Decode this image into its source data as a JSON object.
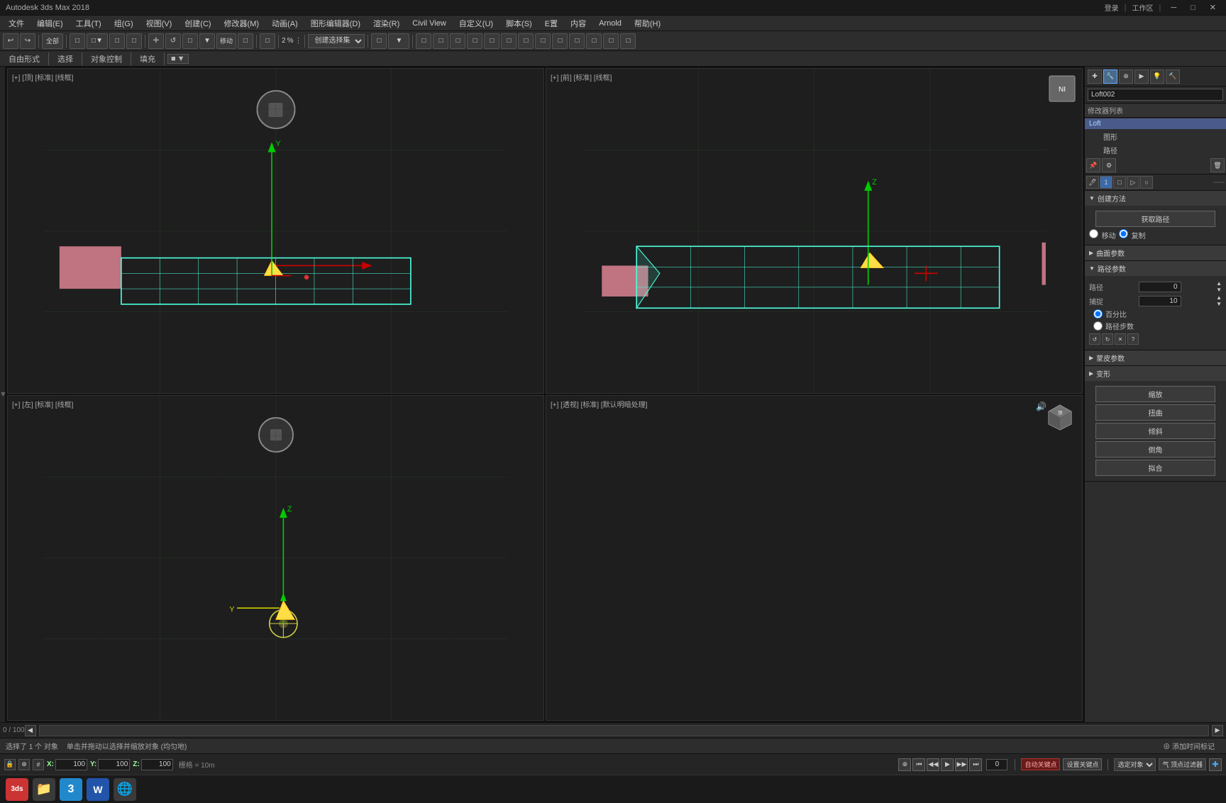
{
  "titleBar": {
    "title": "Autodesk 3ds Max 2018"
  },
  "menuBar": {
    "items": [
      "文件",
      "编辑(E)",
      "工具(T)",
      "组(G)",
      "视图(V)",
      "创建(C)",
      "修改器(M)",
      "动画(A)",
      "图形编辑器(D)",
      "渲染(R)",
      "Civil View",
      "自定义(U)",
      "脚本(S)",
      "E置",
      "内容",
      "Arnold",
      "帮助(H)"
    ]
  },
  "toolbar": {
    "items": [
      "↩",
      "↪",
      "✕",
      "□",
      "□",
      "□",
      "⊕",
      "↺",
      "□",
      "□",
      "□",
      "□",
      "移动",
      "□",
      "□",
      "□",
      "□",
      "□",
      "□",
      "□",
      "□",
      "□",
      "□",
      "□"
    ],
    "dropdown": "创建选择集",
    "percentLabel": "2",
    "percentLabel2": "%"
  },
  "toolbar2": {
    "items": [
      "自由形式",
      "选择",
      "对象控制",
      "填充",
      "■▼"
    ]
  },
  "viewports": {
    "topLeft": {
      "label": "[+] [顶] [标准] [线框]"
    },
    "topRight": {
      "label": "[+] [前] [标准] [线框]"
    },
    "bottomLeft": {
      "label": "[+] [左] [标准] [线框]"
    },
    "bottomRight": {
      "label": "[+] [透视] [标准] [默认明暗处理]"
    }
  },
  "rightPanel": {
    "objectName": "Loft002",
    "modifierListLabel": "修改器列表",
    "buttons": {
      "pin": "📌",
      "config": "⚙",
      "trash": "🗑",
      "check": "✓",
      "close": "✕"
    },
    "modifiers": [
      {
        "name": "Loft",
        "active": true
      },
      {
        "name": "图形",
        "sub": true
      },
      {
        "name": "路径",
        "sub": true
      }
    ],
    "sections": {
      "creationMethod": {
        "label": "创建方法",
        "items": [
          "获取路径",
          "移动",
          "复制"
        ]
      },
      "surfaceParams": {
        "label": "曲面参数"
      },
      "pathParams": {
        "label": "路径参数",
        "path": {
          "label": "路径",
          "value": "0"
        },
        "snap": {
          "label": "捕捉",
          "value": "10"
        },
        "pct": "百分比",
        "pctLabel": "路径步数"
      },
      "skinParams": {
        "label": "蒙皮参数"
      },
      "deform": {
        "label": "变形",
        "buttons": [
          "缩放",
          "扭曲",
          "倾斜",
          "倒角",
          "拟合"
        ]
      }
    }
  },
  "statusBar": {
    "selected": "选择了 1 个 对象",
    "hint": "单击并拖动以选择并缩放对象 (均匀地)",
    "coords": {
      "x": {
        "label": "X:",
        "value": "100"
      },
      "y": {
        "label": "Y:",
        "value": "100"
      },
      "z": {
        "label": "Z:",
        "value": "100"
      }
    },
    "grid": "栅格 = 10m",
    "frameCounter": "0 / 100",
    "autoKeyLabel": "自动关键点",
    "setKeyLabel": "设置关键点",
    "filterLabel": "气 顶点过滤器",
    "timeTag": "⊕ 添加时间标记",
    "playback": {
      "start": "⏮",
      "prev": "◀◀",
      "play": "▶",
      "next": "▶▶",
      "end": "⏭"
    },
    "frameInput": "0",
    "selectLabel": "选定对象"
  },
  "taskbar": {
    "apps": [
      {
        "name": "3dsmax",
        "color": "#cc3333",
        "label": "3ds"
      },
      {
        "name": "explorer",
        "color": "#f0a020",
        "label": "📁"
      },
      {
        "name": "app3",
        "color": "#2288cc",
        "label": "3"
      },
      {
        "name": "word",
        "color": "#2255aa",
        "label": "W"
      },
      {
        "name": "chrome",
        "color": "#4488ee",
        "label": "🌐"
      }
    ]
  },
  "colors": {
    "accent": "#4af",
    "background": "#1e1e1e",
    "panelBg": "#2d2d2d",
    "gridColor": "#3a4a3a",
    "objectTeal": "#4dffdd",
    "objectYellow": "#ffdd44",
    "objectPink": "#ffaabb"
  }
}
